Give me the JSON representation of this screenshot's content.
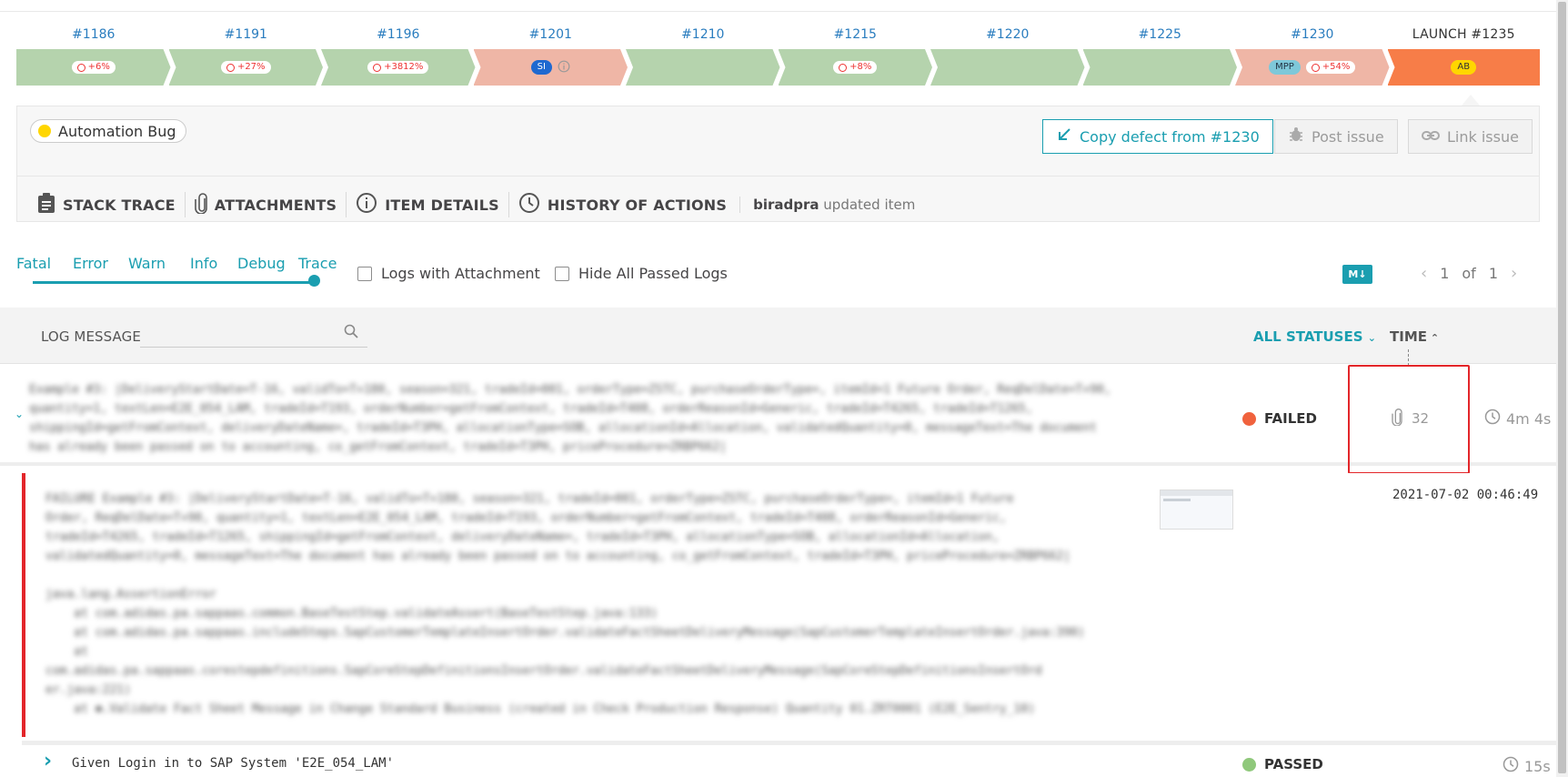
{
  "history": {
    "items": [
      {
        "num": "#1186",
        "color": "#b5d3ad",
        "badges": [
          {
            "type": "dur",
            "text": "+6%"
          }
        ]
      },
      {
        "num": "#1191",
        "color": "#b5d3ad",
        "badges": [
          {
            "type": "dur",
            "text": "+27%"
          }
        ]
      },
      {
        "num": "#1196",
        "color": "#b5d3ad",
        "badges": [
          {
            "type": "dur",
            "text": "+3812%"
          }
        ]
      },
      {
        "num": "#1201",
        "color": "#efb6a6",
        "badges": [
          {
            "type": "tag",
            "text": "SI",
            "bg": "#1f69d0",
            "fg": "#fff"
          },
          {
            "type": "info"
          }
        ]
      },
      {
        "num": "#1210",
        "color": "#b5d3ad",
        "badges": []
      },
      {
        "num": "#1215",
        "color": "#b5d3ad",
        "badges": [
          {
            "type": "dur",
            "text": "+8%"
          }
        ]
      },
      {
        "num": "#1220",
        "color": "#b5d3ad",
        "badges": []
      },
      {
        "num": "#1225",
        "color": "#b5d3ad",
        "badges": []
      },
      {
        "num": "#1230",
        "color": "#efb6a6",
        "badges": [
          {
            "type": "tag",
            "text": "MPP",
            "bg": "#7ec8d9",
            "fg": "#234"
          },
          {
            "type": "dur",
            "text": "+54%"
          }
        ]
      },
      {
        "num": "LAUNCH #1235",
        "color": "#f77d48",
        "badges": [
          {
            "type": "tag",
            "text": "AB",
            "bg": "#ffd600",
            "fg": "#333"
          }
        ]
      }
    ]
  },
  "defect": {
    "type_label": "Automation Bug",
    "type_color": "#ffd600",
    "copy_btn": "Copy defect from #1230",
    "post_btn": "Post issue",
    "link_btn": "Link issue"
  },
  "tabs": {
    "stack": "STACK TRACE",
    "attachments": "ATTACHMENTS",
    "details": "ITEM DETAILS",
    "history": "HISTORY OF ACTIONS",
    "note_user": "biradpra",
    "note_text": " updated item"
  },
  "levels": [
    "Fatal",
    "Error",
    "Warn",
    "Info",
    "Debug",
    "Trace"
  ],
  "filters": {
    "logs_with_attachment": "Logs with Attachment",
    "hide_passed": "Hide All Passed Logs",
    "md": "M↓"
  },
  "pager": {
    "current": "1",
    "of": "of",
    "total": "1"
  },
  "log_header": {
    "title": "LOG MESSAGE",
    "search_placeholder": "",
    "statuses": "ALL STATUSES",
    "time": "TIME"
  },
  "rows": {
    "row1": {
      "message": "Example #3: |DeliveryStartDate=T-16, validTo=T+180, season=321, tradeId=001, orderType=ZSTC, purchaseOrderType=, itemId=1 Future Order, ReqDelDate=T+90, quantity=1, textLen=E2E_054_LAM, tradeId=T193, orderNumber=getFromContext, tradeId=T408, orderReasonId=Generic, tradeId=T4265, tradeId=T1265, shippingId=getFromContext, deliveryDateName=, tradeId=T3PH, allocationType=SOB, allocationId=Allocation, validatedQuantity=0, messageText=The document has already been passed on to accounting, co_getFromContext, tradeId=T3PH, priceProcedure=ZRBP662|",
      "status": "FAILED",
      "status_color": "#f0623d",
      "attachments": "32",
      "time": "4m 4s"
    },
    "row2": {
      "message": "FAILURE Example #3: |DeliveryStartDate=T-16, validTo=T+180, season=321, tradeId=001, orderType=ZSTC, purchaseOrderType=, itemId=1 Future\nOrder, ReqDelDate=T+90, quantity=1, textLen=E2E_054_LAM, tradeId=T193, orderNumber=getFromContext, tradeId=T408, orderReasonId=Generic,\ntradeId=T4265, tradeId=T1265, shippingId=getFromContext, deliveryDateName=, tradeId=T3PH, allocationType=SOB, allocationId=Allocation,\nvalidatedQuantity=0, messageText=The document has already been passed on to accounting, co_getFromContext, tradeId=T3PH, priceProcedure=ZRBP662|\n\njava.lang.AssertionError\n    at com.adidas.pa.sappaas.common.BaseTestStep.validateAssert(BaseTestStep.java:133)\n    at com.adidas.pa.sappaas.includeSteps.SapCustomerTemplateInsertOrder.validateFactSheetDeliveryMessage(SapCustomerTemplateInsertOrder.java:390)\n    at\ncom.adidas.pa.sappaas.corestepdefinitions.SapCoreStepDefinitionsInsertOrder.validateFactSheetDeliveryMessage(SapCoreStepDefinitionsInsertOrd\ner.java:221)\n    at ✽.Validate Fact Sheet Message in Change Standard Business (created in Check Production Response) Quantity 01.ZRT0001 (E2E_Sentry_10)",
      "timestamp": "2021-07-02 00:46:49"
    },
    "row3": {
      "message": "Given Login in to SAP System 'E2E_054_LAM'",
      "status": "PASSED",
      "status_color": "#8fc87b",
      "time": "15s"
    }
  }
}
